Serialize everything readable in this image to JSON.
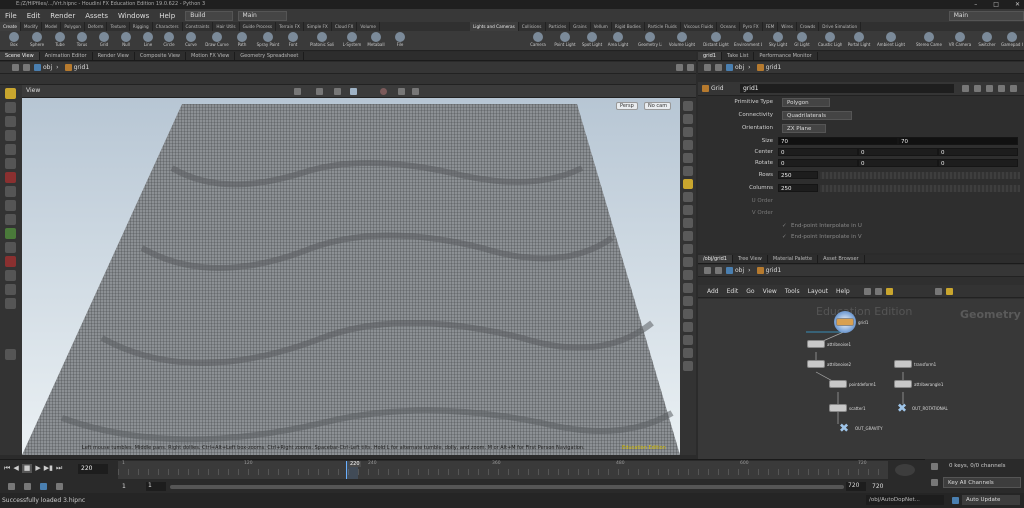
{
  "title_bar": {
    "text": "E:/Z/HIPfiles/.../Vrt.hipnc - Houdini FX Education Edition 19.0.622 - Python 3"
  },
  "menubar": {
    "items": [
      "File",
      "Edit",
      "Render",
      "Assets",
      "Windows",
      "Help"
    ],
    "build_label": "Build",
    "main_label": "Main",
    "desktop_label": "Main"
  },
  "shelf_tabs_left": [
    "Create",
    "Modify",
    "Model",
    "Polygon",
    "Deform",
    "Texture",
    "Rigging",
    "Characters",
    "Constraints",
    "Hair Utils",
    "Guide Process",
    "Terrain FX",
    "Simple FX",
    "Cloud FX",
    "Volume"
  ],
  "shelf_tabs_right": [
    "Lights and Cameras",
    "Collisions",
    "Particles",
    "Grains",
    "Vellum",
    "Rigid Bodies",
    "Particle Fluids",
    "Viscous Fluids",
    "Oceans",
    "Pyro FX",
    "FEM",
    "Wires",
    "Crowds",
    "Drive Simulation"
  ],
  "shelf_tools_left": [
    "Box",
    "Sphere",
    "Tube",
    "Torus",
    "Grid",
    "Null",
    "Line",
    "Circle",
    "Curve",
    "Draw Curve",
    "Path",
    "Spray Paint",
    "Font",
    "Platonic Solids",
    "L-System",
    "Metaball",
    "File"
  ],
  "shelf_tools_right": [
    "Camera",
    "Point Light",
    "Spot Light",
    "Area Light",
    "Geometry Light",
    "Volume Light",
    "Distant Light",
    "Environment Light",
    "Sky Light",
    "GI Light",
    "Caustic Light",
    "Portal Light",
    "Ambient Light",
    "Stereo Camera",
    "VR Camera",
    "Switcher",
    "Gamepad Camera"
  ],
  "left_pane_tabs": [
    "Scene View",
    "Animation Editor",
    "Render View",
    "Composite View",
    "Motion FX View",
    "Geometry Spreadsheet"
  ],
  "left_path": {
    "obj": "obj",
    "node": "grid1"
  },
  "viewport": {
    "label": "View",
    "persp": "Persp",
    "cam": "No cam",
    "hint": "Left mouse tumbles. Middle pans. Right dollies. Ctrl+Alt+Left box-zooms. Ctrl+Right zooms. Spacebar-Ctrl-Left tilts. Hold L for alternate tumble, dolly, and zoom.    M or Alt+M for First Person Navigation.",
    "hint2": "Education Edition"
  },
  "param_pane_tabs": [
    "grid1",
    "Take List",
    "Performance Monitor"
  ],
  "param_path": {
    "obj": "obj",
    "node": "grid1"
  },
  "param_header": {
    "type": "Grid",
    "name": "grid1"
  },
  "params": {
    "primitive_type": {
      "label": "Primitive Type",
      "value": "Polygon"
    },
    "connectivity": {
      "label": "Connectivity",
      "value": "Quadrilaterals"
    },
    "orientation": {
      "label": "Orientation",
      "value": "ZX Plane"
    },
    "size": {
      "label": "Size",
      "x": "70",
      "y": "70"
    },
    "center": {
      "label": "Center",
      "x": "0",
      "y": "0",
      "z": "0"
    },
    "rotate": {
      "label": "Rotate",
      "x": "0",
      "y": "0",
      "z": "0"
    },
    "rows": {
      "label": "Rows",
      "value": "250"
    },
    "columns": {
      "label": "Columns",
      "value": "250"
    },
    "u_order": {
      "label": "U Order"
    },
    "v_order": {
      "label": "V Order"
    },
    "interp_u": "End-point Interpolate in U",
    "interp_v": "End-point Interpolate in V"
  },
  "network_tabs": [
    "/obj/grid1",
    "Tree View",
    "Material Palette",
    "Asset Browser"
  ],
  "network_path": {
    "obj": "obj",
    "node": "grid1"
  },
  "network_menu": [
    "Add",
    "Edit",
    "Go",
    "View",
    "Tools",
    "Layout",
    "Help"
  ],
  "network_watermark": "Education Edition",
  "network_context": "Geometry",
  "nodes": {
    "grid": "grid1",
    "attribnoise": "attribnoise1",
    "attribnoise2": "attribnoise2",
    "transform": "transform1",
    "pointdeform": "pointdeform1",
    "attribwrangle": "attribwrangle1",
    "scatter": "scatter1",
    "out_rotational": "OUT_ROTATIONAL",
    "out_gravity": "OUT_GRAVITY"
  },
  "timeline": {
    "current_frame": "220",
    "ticks": [
      "1",
      "120",
      "240",
      "360",
      "480",
      "600",
      "720"
    ],
    "start": "1",
    "start2": "1",
    "end": "720",
    "end2": "720",
    "keys_label": "0 keys, 0/0 channels",
    "key_all": "Key All Channels"
  },
  "status": {
    "message": "Successfully loaded 3.hipnc",
    "path_field": "/obj/AutoDopNet...",
    "auto_update": "Auto Update"
  }
}
